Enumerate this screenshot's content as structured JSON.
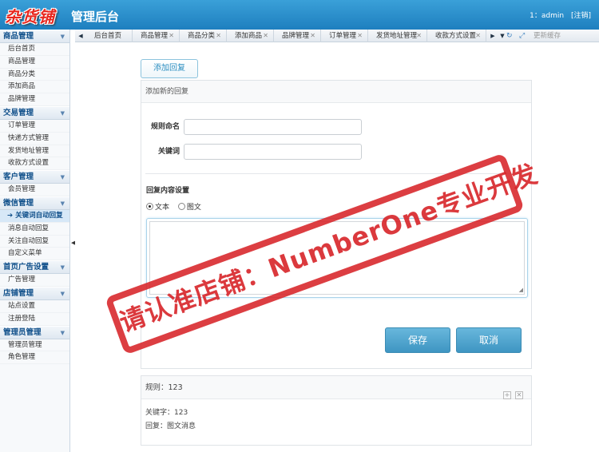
{
  "header": {
    "logo": "杂货铺",
    "title": "管理后台",
    "user": "1：admin",
    "logout": "[注销]"
  },
  "sidebar": {
    "groups": [
      {
        "title": "商品管理",
        "items": [
          "后台首页",
          "商品管理",
          "商品分类",
          "添加商品",
          "品牌管理"
        ]
      },
      {
        "title": "交易管理",
        "items": [
          "订单管理",
          "快递方式管理",
          "发货地址管理",
          "收款方式设置"
        ]
      },
      {
        "title": "客户管理",
        "items": [
          "会员管理"
        ]
      },
      {
        "title": "微信管理",
        "items": [
          "➔ 关键词自动回复",
          "消息自动回复",
          "关注自动回复",
          "自定义菜单"
        ]
      },
      {
        "title": "首页广告设置",
        "items": [
          "广告管理"
        ]
      },
      {
        "title": "店铺管理",
        "items": [
          "站点设置",
          "注册登陆"
        ]
      },
      {
        "title": "管理员管理",
        "items": [
          "管理员管理",
          "角色管理"
        ]
      }
    ]
  },
  "tabs": [
    "后台首页",
    "商品管理",
    "商品分类",
    "添加商品",
    "品牌管理",
    "订单管理",
    "发货地址管理",
    "收款方式设置"
  ],
  "toolbar": {
    "clear_cache": "更新缓存"
  },
  "main": {
    "add_reply": "添加回复",
    "panel_title": "添加新的回复",
    "rule_name_label": "规则命名",
    "rule_name_value": "",
    "keyword_label": "关键词",
    "keyword_value": "",
    "reply_settings": "回复内容设置",
    "radio_text": "文本",
    "radio_image": "图文",
    "textarea_value": "",
    "save": "保存",
    "cancel": "取消"
  },
  "rule": {
    "title": "规则：123",
    "keyword": "关键字：123",
    "reply": "回复：图文消息"
  },
  "watermark": "请认准店铺：NumberOne专业开发",
  "colors": {
    "header": "#1e7fbf",
    "stamp": "#d72328",
    "button": "#4aa0cc"
  }
}
